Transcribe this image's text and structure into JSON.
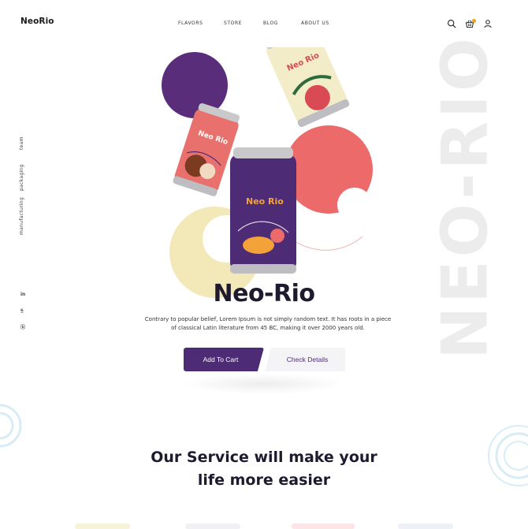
{
  "header": {
    "logo": "NeoRio",
    "nav": [
      "FLAVORS",
      "STORE",
      "BLOG",
      "ABOUT US"
    ],
    "icons": [
      "search-icon",
      "basket-icon",
      "user-icon"
    ],
    "cart_count": ""
  },
  "side_links": [
    "team",
    "packaging",
    "manufacturing"
  ],
  "social": [
    "in",
    "ɢ̲",
    "ⓑ"
  ],
  "watermark": "NEO-RIO",
  "hero": {
    "title": "Neo-Rio",
    "description_line1": "Contrary to popular belief, Lorem Ipsum is not simply random text. It has roots in a piece",
    "description_line2": "of classical Latin literature from 45 BC, making it over 2000 years old.",
    "add_to_cart": "Add To Cart",
    "check_details": "Check Details"
  },
  "cans": {
    "brand": "Neo Rio"
  },
  "service": {
    "title_line1": "Our Service will make your",
    "title_line2": "life more easier"
  },
  "colors": {
    "purple": "#4d2b75",
    "coral": "#ec6a6a",
    "cream": "#f3e8b8",
    "pink": "#e9716d",
    "badge": "#f1a21b"
  }
}
